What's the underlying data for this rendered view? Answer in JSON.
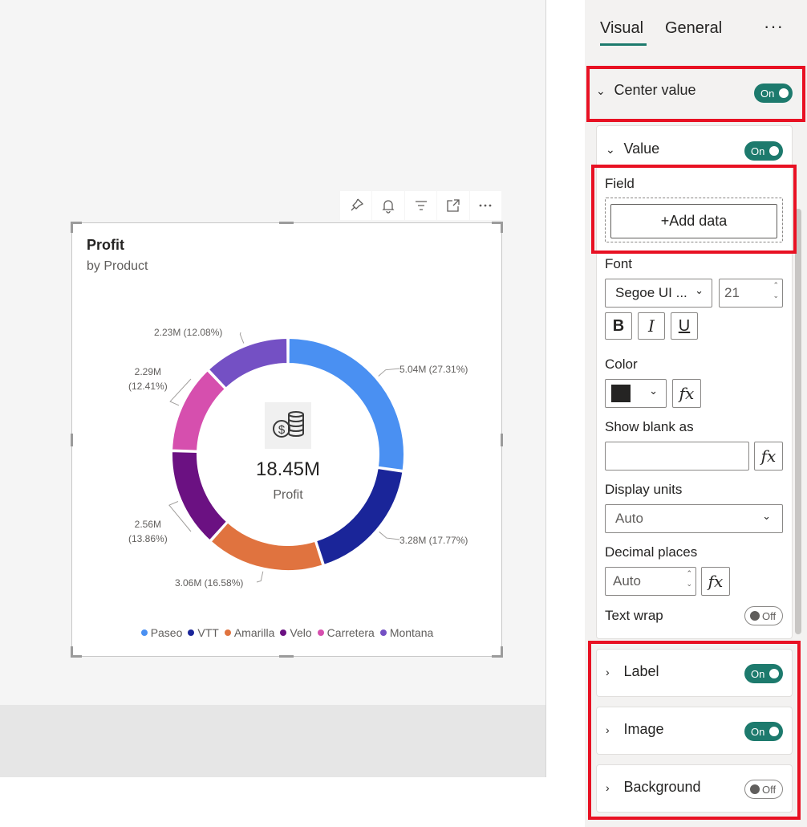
{
  "visual": {
    "title": "Profit",
    "subtitle": "by Product",
    "center_value": "18.45M",
    "center_label": "Profit",
    "center_icon": "money-coins-icon"
  },
  "toolbar_icons": [
    "pin-icon",
    "bell-icon",
    "filter-icon",
    "focus-mode-icon",
    "more-options-icon"
  ],
  "chart_data": {
    "type": "pie",
    "style": "donut",
    "title": "Profit",
    "subtitle": "by Product",
    "total_label": "18.45M",
    "unit": "M",
    "slices": [
      {
        "name": "Paseo",
        "value": 5.04,
        "percent": 27.31,
        "label": "5.04M (27.31%)",
        "color": "#4a90f2"
      },
      {
        "name": "VTT",
        "value": 3.28,
        "percent": 17.77,
        "label": "3.28M (17.77%)",
        "color": "#1a2599"
      },
      {
        "name": "Amarilla",
        "value": 3.06,
        "percent": 16.58,
        "label": "3.06M (16.58%)",
        "color": "#e0733f"
      },
      {
        "name": "Velo",
        "value": 2.56,
        "percent": 13.86,
        "label1": "2.56M",
        "label2": "(13.86%)",
        "color": "#6b1182"
      },
      {
        "name": "Carretera",
        "value": 2.29,
        "percent": 12.41,
        "label1": "2.29M",
        "label2": "(12.41%)",
        "color": "#d64fae"
      },
      {
        "name": "Montana",
        "value": 2.23,
        "percent": 12.08,
        "label": "2.23M (12.08%)",
        "color": "#7450c4"
      }
    ],
    "legend": [
      "Paseo",
      "VTT",
      "Amarilla",
      "Velo",
      "Carretera",
      "Montana"
    ],
    "legend_position": "bottom"
  },
  "pane": {
    "tabs": {
      "visual": "Visual",
      "general": "General"
    },
    "more": "···",
    "center_value": {
      "title": "Center value",
      "toggle": "On"
    },
    "value": {
      "title": "Value",
      "toggle": "On",
      "field_label": "Field",
      "add_data": "+Add data",
      "font_label": "Font",
      "font_family": "Segoe UI ...",
      "font_size": "21",
      "bold": "B",
      "italic": "I",
      "underline": "U",
      "color_label": "Color",
      "color_value": "#252423",
      "blank_label": "Show blank as",
      "blank_value": "",
      "units_label": "Display units",
      "units_value": "Auto",
      "decimal_label": "Decimal places",
      "decimal_value": "Auto",
      "wrap_label": "Text wrap",
      "wrap_toggle": "Off",
      "fx": "fx"
    },
    "label": {
      "title": "Label",
      "toggle": "On"
    },
    "image": {
      "title": "Image",
      "toggle": "On"
    },
    "background": {
      "title": "Background",
      "toggle": "Off"
    }
  },
  "highlight_color": "#e81123",
  "accent_color": "#1d7a6d"
}
